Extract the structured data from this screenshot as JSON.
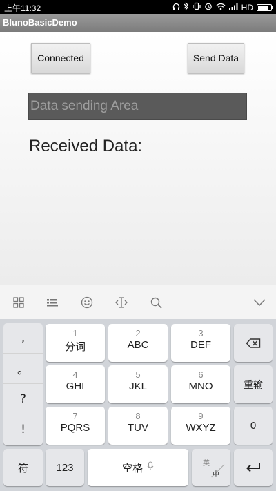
{
  "status": {
    "time": "上午11:32",
    "network": "HD",
    "icons": [
      "headset-icon",
      "bluetooth-icon",
      "vibrate-icon",
      "alarm-icon",
      "wifi-icon",
      "signal-icon",
      "battery-icon"
    ],
    "battery_level": 0.85
  },
  "app": {
    "title": "BlunoBasicDemo"
  },
  "main": {
    "connect_button": "Connected",
    "send_button": "Send Data",
    "input_placeholder": "Data sending Area",
    "received_label": "Received Data:"
  },
  "keyboard": {
    "toolbar": [
      "grid-icon",
      "keyboard-icon",
      "emoji-icon",
      "cursor-icon",
      "search-icon",
      "chevron-down-icon"
    ],
    "punctuation": [
      ",",
      "。",
      "?",
      "!"
    ],
    "keys": [
      {
        "num": "1",
        "label": "分词"
      },
      {
        "num": "2",
        "label": "ABC"
      },
      {
        "num": "3",
        "label": "DEF"
      },
      {
        "num": "4",
        "label": "GHI"
      },
      {
        "num": "5",
        "label": "JKL"
      },
      {
        "num": "6",
        "label": "MNO"
      },
      {
        "num": "7",
        "label": "PQRS"
      },
      {
        "num": "8",
        "label": "TUV"
      },
      {
        "num": "9",
        "label": "WXYZ"
      }
    ],
    "reenter": "重输",
    "zero": "0",
    "symbols": "符",
    "numbers": "123",
    "space": "空格",
    "lang_en": "英",
    "lang_zh": "中"
  }
}
